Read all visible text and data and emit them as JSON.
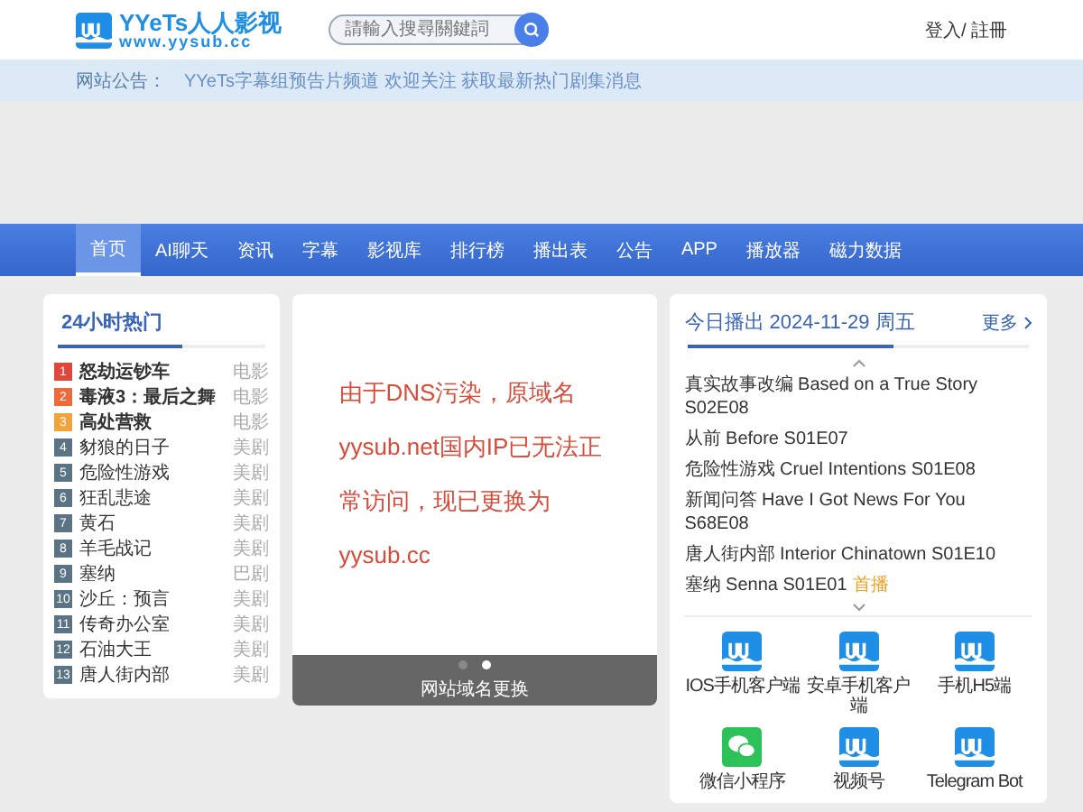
{
  "header": {
    "logo_title": "YYeTs人人影视",
    "logo_url": "www.yysub.cc",
    "search": {
      "placeholder": "請輸入搜尋關鍵詞"
    },
    "login": "登入/ 註冊"
  },
  "announcement": {
    "label": "网站公告：",
    "text": "YYeTs字幕组预告片频道 欢迎关注 获取最新热门剧集消息"
  },
  "nav": [
    {
      "label": "首页",
      "selected": true
    },
    {
      "label": "AI聊天",
      "selected": false
    },
    {
      "label": "资讯",
      "selected": false
    },
    {
      "label": "字幕",
      "selected": false
    },
    {
      "label": "影视库",
      "selected": false
    },
    {
      "label": "排行榜",
      "selected": false
    },
    {
      "label": "播出表",
      "selected": false
    },
    {
      "label": "公告",
      "selected": false
    },
    {
      "label": "APP",
      "selected": false
    },
    {
      "label": "播放器",
      "selected": false
    },
    {
      "label": "磁力数据",
      "selected": false
    }
  ],
  "hot": {
    "title": "24小时热门",
    "items": [
      {
        "rank": "1",
        "title": "怒劫运钞车",
        "type": "电影",
        "color": "#e0463a",
        "highlighted": true
      },
      {
        "rank": "2",
        "title": "毒液3：最后之舞",
        "type": "电影",
        "color": "#ee6a3a",
        "highlighted": true
      },
      {
        "rank": "3",
        "title": "高处营救",
        "type": "电影",
        "color": "#f2a33a",
        "highlighted": true
      },
      {
        "rank": "4",
        "title": "豺狼的日子",
        "type": "美剧",
        "color": "#5a7486",
        "highlighted": false
      },
      {
        "rank": "5",
        "title": "危险性游戏",
        "type": "美剧",
        "color": "#5a7486",
        "highlighted": false
      },
      {
        "rank": "6",
        "title": "狂乱悲途",
        "type": "美剧",
        "color": "#5a7486",
        "highlighted": false
      },
      {
        "rank": "7",
        "title": "黄石",
        "type": "美剧",
        "color": "#5a7486",
        "highlighted": false
      },
      {
        "rank": "8",
        "title": "羊毛战记",
        "type": "美剧",
        "color": "#5a7486",
        "highlighted": false
      },
      {
        "rank": "9",
        "title": "塞纳",
        "type": "巴剧",
        "color": "#5a7486",
        "highlighted": false
      },
      {
        "rank": "10",
        "title": "沙丘：预言",
        "type": "美剧",
        "color": "#5a7486",
        "highlighted": false
      },
      {
        "rank": "11",
        "title": "传奇办公室",
        "type": "美剧",
        "color": "#5a7486",
        "highlighted": false
      },
      {
        "rank": "12",
        "title": "石油大王",
        "type": "美剧",
        "color": "#5a7486",
        "highlighted": false
      },
      {
        "rank": "13",
        "title": "唐人街内部",
        "type": "美剧",
        "color": "#5a7486",
        "highlighted": false
      }
    ]
  },
  "carousel": {
    "message": "由于DNS污染，原域名yysub.net国内IP已无法正常访问，现已更换为yysub.cc",
    "caption": "网站域名更换",
    "dots": [
      {
        "selected": false
      },
      {
        "selected": true
      }
    ]
  },
  "schedule": {
    "title": "今日播出 2024-11-29 周五",
    "more": "更多",
    "items": [
      {
        "text": "真实故事改编 Based on a True Story S02E08"
      },
      {
        "text": "从前 Before S01E07"
      },
      {
        "text": "危险性游戏 Cruel Intentions S01E08"
      },
      {
        "text": "新闻问答 Have I Got News For You S68E08"
      },
      {
        "text": "唐人街内部 Interior Chinatown S01E10"
      },
      {
        "text": "塞纳 Senna S01E01",
        "badge": "首播"
      }
    ]
  },
  "apps": [
    {
      "label": "IOS手机客户端",
      "kind": "app"
    },
    {
      "label": "安卓手机客户端",
      "kind": "app"
    },
    {
      "label": "手机H5端",
      "kind": "app"
    },
    {
      "label": "微信小程序",
      "kind": "wechat"
    },
    {
      "label": "视频号",
      "kind": "app"
    },
    {
      "label": "Telegram Bot",
      "kind": "app"
    }
  ]
}
